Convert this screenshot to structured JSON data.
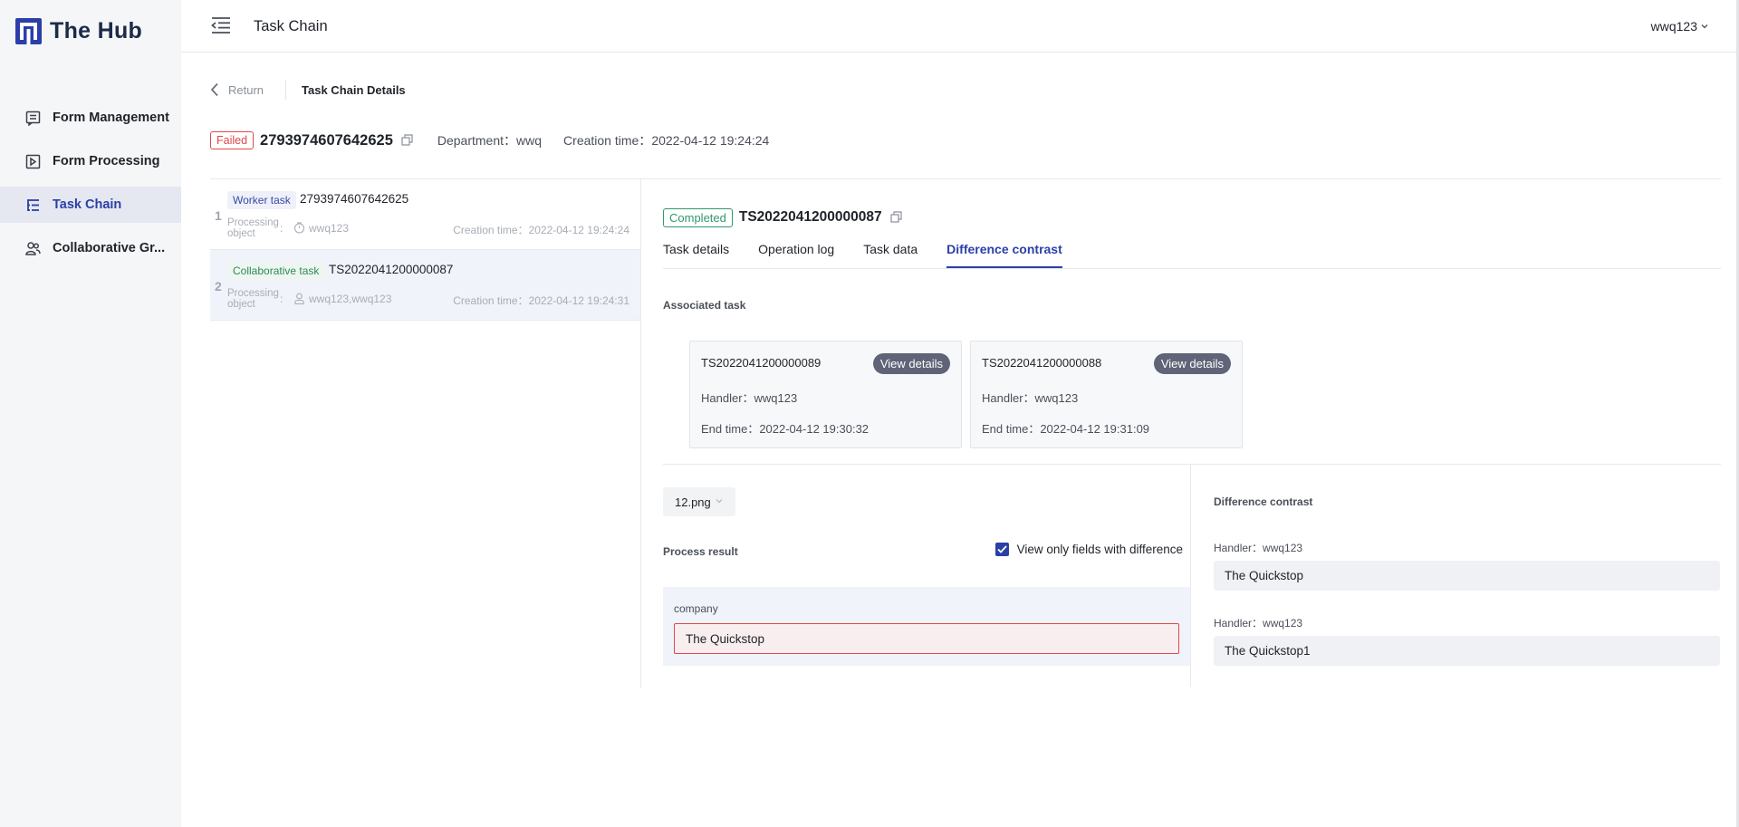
{
  "app": {
    "name": "The Hub",
    "brand_color": "#2b3fa8"
  },
  "sidebar": {
    "items": [
      {
        "label": "Form Management",
        "icon": "form-list-icon"
      },
      {
        "label": "Form Processing",
        "icon": "form-edit-icon"
      },
      {
        "label": "Task Chain",
        "icon": "task-chain-icon",
        "active": true
      },
      {
        "label": "Collaborative Gr...",
        "icon": "group-icon"
      }
    ]
  },
  "header": {
    "title": "Task Chain",
    "user": "wwq123"
  },
  "breadcrumb": {
    "return_label": "Return",
    "current": "Task Chain Details"
  },
  "chain": {
    "status": "Failed",
    "status_color": "#e04848",
    "id": "2793974607642625",
    "department_label": "Department：",
    "department": "wwq",
    "created_label": "Creation time：",
    "created": "2022-04-12 19:24:24"
  },
  "tasks": [
    {
      "index": "1",
      "type": "Worker task",
      "code": "2793974607642625",
      "object_label": "Processing object",
      "colon": ":",
      "object": "wwq123",
      "time_label": "Creation time：",
      "time": "2022-04-12 19:24:24"
    },
    {
      "index": "2",
      "type": "Collaborative task",
      "code": "TS2022041200000087",
      "object_label": "Processing object",
      "colon": ":",
      "object": "wwq123,wwq123",
      "time_label": "Creation time：",
      "time": "2022-04-12 19:24:31"
    }
  ],
  "detail": {
    "status": "Completed",
    "status_color": "#2f9a6a",
    "id": "TS2022041200000087",
    "tabs": [
      "Task details",
      "Operation log",
      "Task data",
      "Difference contrast"
    ],
    "active_tab": "Difference contrast",
    "associated_label": "Associated task",
    "associated": [
      {
        "code": "TS2022041200000089",
        "button": "View details",
        "handler_label": "Handler：",
        "handler": "wwq123",
        "end_label": "End time：",
        "end_time": "2022-04-12 19:30:32"
      },
      {
        "code": "TS2022041200000088",
        "button": "View details",
        "handler_label": "Handler：",
        "handler": "wwq123",
        "end_label": "End time：",
        "end_time": "2022-04-12 19:31:09"
      }
    ],
    "file": "12.png",
    "process_result_label": "Process result",
    "only_diff_label": "View only fields with difference",
    "field_name": "company",
    "field_value": "The Quickstop",
    "diff_title": "Difference contrast",
    "diffs": [
      {
        "handler_label": "Handler：",
        "handler": "wwq123",
        "value": "The Quickstop"
      },
      {
        "handler_label": "Handler：",
        "handler": "wwq123",
        "value": "The Quickstop1"
      }
    ]
  }
}
